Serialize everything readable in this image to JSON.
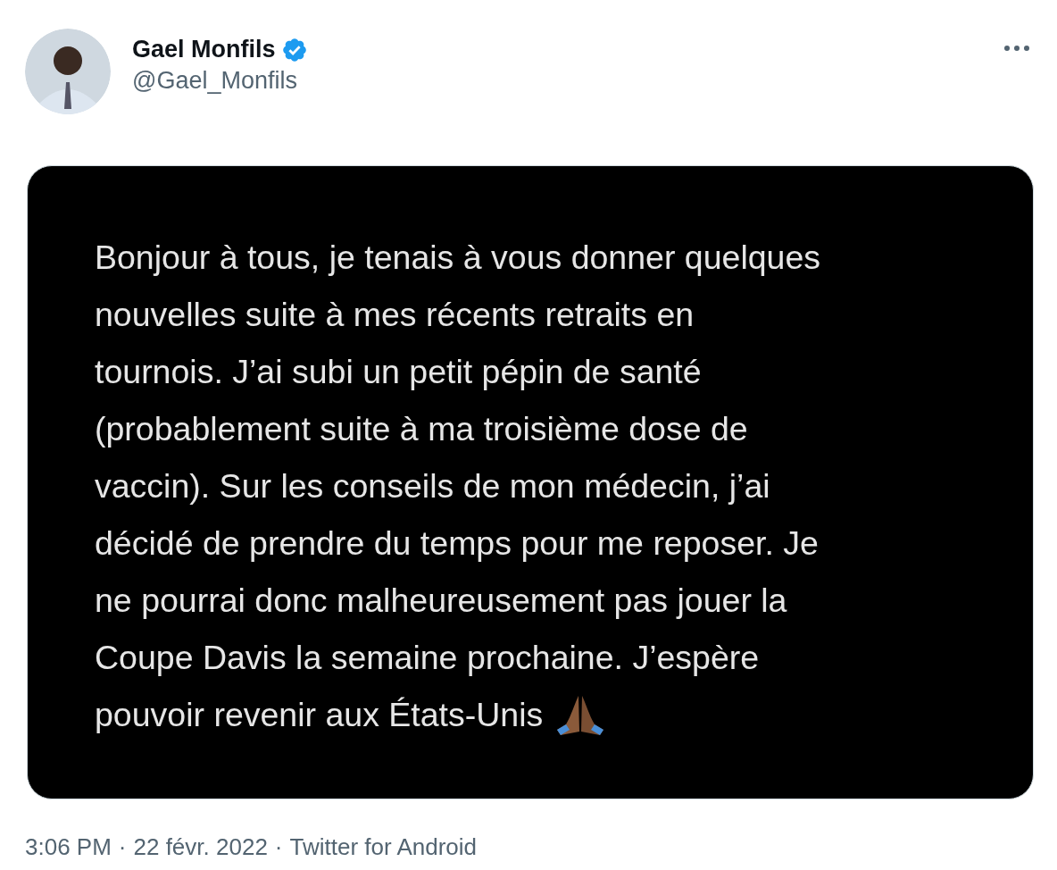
{
  "author": {
    "name": "Gael Monfils",
    "verified": true,
    "handle": "@Gael_Monfils"
  },
  "image_lines": [
    "Bonjour à tous, je tenais à vous donner quelques",
    "nouvelles suite à mes récents retraits en",
    "tournois. J’ai subi un petit pépin de santé",
    "(probablement suite à ma troisième dose de",
    "vaccin). Sur les conseils de mon médecin, j’ai",
    "décidé de prendre du temps pour me reposer. Je",
    "ne pourrai donc malheureusement pas jouer la",
    "Coupe Davis la semaine prochaine. J’espère",
    "pouvoir revenir aux États-Unis"
  ],
  "footer": {
    "time": "3:06 PM",
    "separator_1": "·",
    "date": "22 févr. 2022",
    "separator_2": "·",
    "source": "Twitter for Android"
  }
}
